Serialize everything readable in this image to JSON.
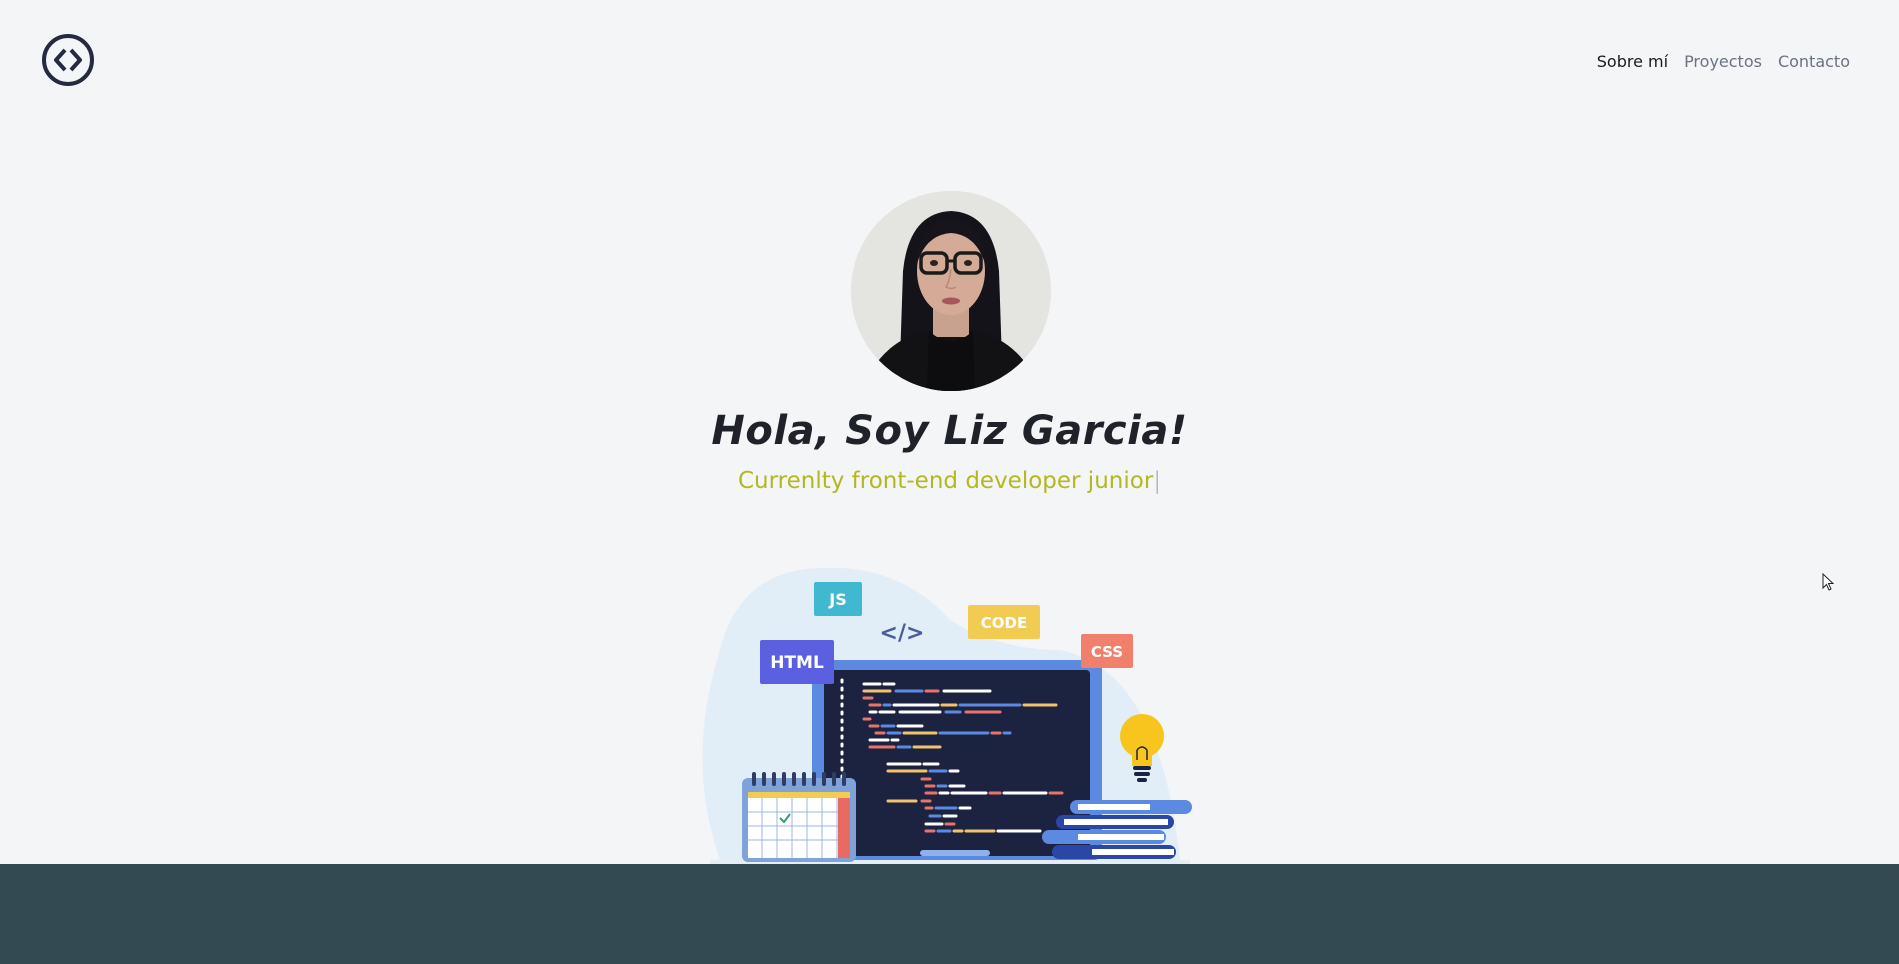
{
  "header": {
    "logo_icon": "code-brackets-icon",
    "nav": [
      {
        "label": "Sobre mí",
        "active": true
      },
      {
        "label": "Proyectos",
        "active": false
      },
      {
        "label": "Contacto",
        "active": false
      }
    ]
  },
  "hero": {
    "title": "Hola, Soy Liz Garcia!",
    "subtitle": "Currenlty front-end developer junior",
    "caret": "|"
  },
  "illustration": {
    "tags": {
      "js": "JS",
      "html": "HTML",
      "code": "CODE",
      "css": "CSS",
      "tag": "</>"
    }
  },
  "colors": {
    "background": "#f4f5f7",
    "footer": "#334a53",
    "accent_subtitle": "#b3b81f",
    "title": "#1f2229"
  }
}
